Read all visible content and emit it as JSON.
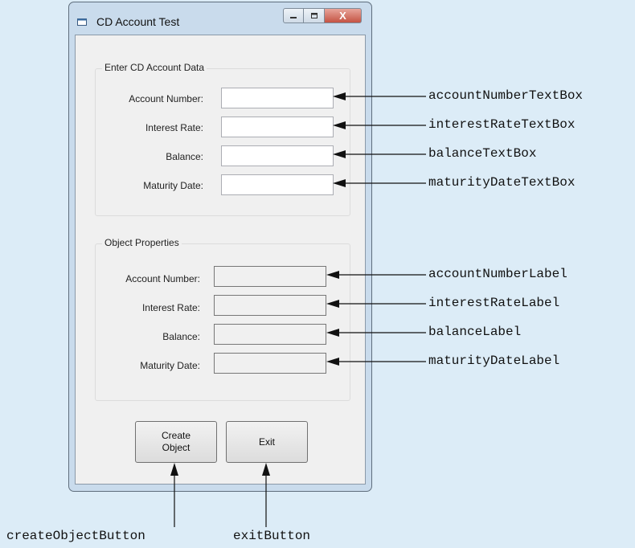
{
  "window": {
    "title": "CD Account Test",
    "icons": {
      "app": "app-window-icon",
      "minimize": "minimize-icon",
      "maximize": "maximize-icon",
      "close": "close-icon"
    },
    "close_glyph": "X"
  },
  "input_group": {
    "title": "Enter CD Account Data",
    "fields": [
      {
        "label": "Account Number:",
        "value": ""
      },
      {
        "label": "Interest Rate:",
        "value": ""
      },
      {
        "label": "Balance:",
        "value": ""
      },
      {
        "label": "Maturity Date:",
        "value": ""
      }
    ]
  },
  "output_group": {
    "title": "Object Properties",
    "fields": [
      {
        "label": "Account Number:",
        "value": ""
      },
      {
        "label": "Interest Rate:",
        "value": ""
      },
      {
        "label": "Balance:",
        "value": ""
      },
      {
        "label": "Maturity Date:",
        "value": ""
      }
    ]
  },
  "buttons": {
    "create": "Create\nObject",
    "exit": "Exit"
  },
  "callouts": {
    "accountNumberTextBox": "accountNumberTextBox",
    "interestRateTextBox": "interestRateTextBox",
    "balanceTextBox": "balanceTextBox",
    "maturityDateTextBox": "maturityDateTextBox",
    "accountNumberLabel": "accountNumberLabel",
    "interestRateLabel": "interestRateLabel",
    "balanceLabel": "balanceLabel",
    "maturityDateLabel": "maturityDateLabel",
    "createObjectButton": "createObjectButton",
    "exitButton": "exitButton"
  },
  "colors": {
    "background": "#dcecf7",
    "window_frame": "#c9dbec",
    "client": "#f0f0f0",
    "close_button": "#c55343"
  }
}
